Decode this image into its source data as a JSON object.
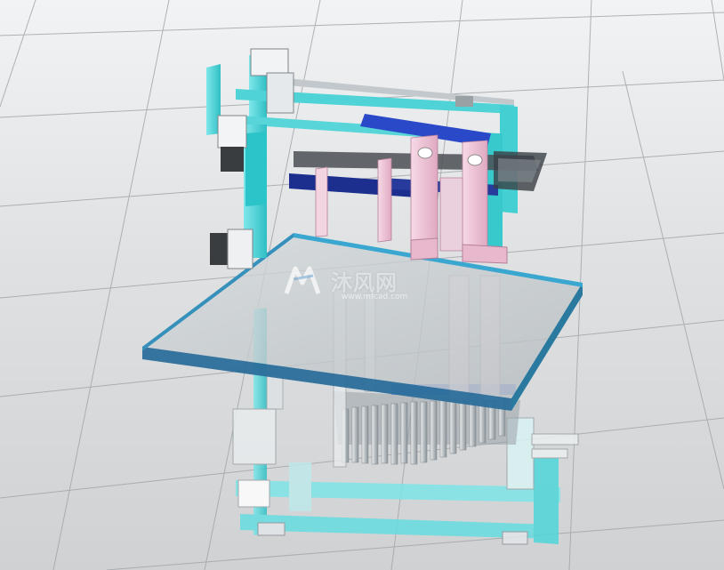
{
  "watermark": {
    "brand_text": "沐风网",
    "url_text": "www.mfcad.com",
    "logo_icon": "mf-logo-icon"
  },
  "colors": {
    "frame_cyan": "#3fd3d6",
    "column_pink": "#f0c3d8",
    "plate_gray": "#c4cacd",
    "plate_edge_blue": "#2b6e9a",
    "rail_blue": "#2a49c9",
    "motor_dark": "#3a3d40",
    "background": "#dfe1e2",
    "grid_line": "#9fa3a7"
  },
  "scene_parts": [
    "top-gantry-frame",
    "stepper-motor",
    "linear-guide-rail",
    "pink-lift-columns",
    "mounting-plate",
    "lower-cyan-frame",
    "pin-gripper-array",
    "side-bracket"
  ]
}
